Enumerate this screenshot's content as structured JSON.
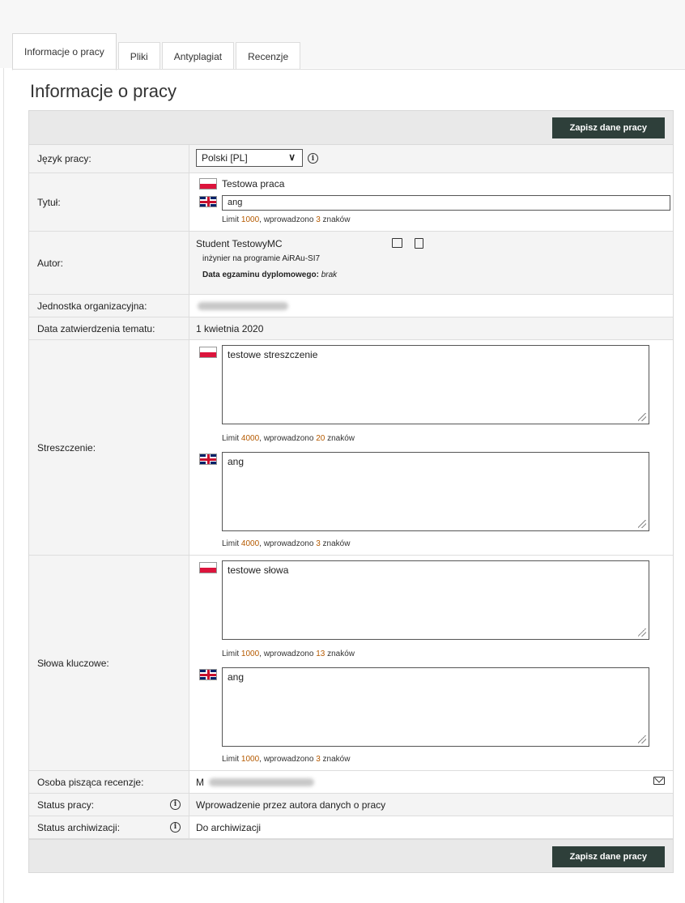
{
  "tabs": [
    {
      "label": "Informacje o pracy",
      "active": true
    },
    {
      "label": "Pliki"
    },
    {
      "label": "Antyplagiat"
    },
    {
      "label": "Recenzje"
    }
  ],
  "page_title": "Informacje o pracy",
  "save_label": "Zapisz dane pracy",
  "rows": {
    "language": {
      "label": "Język pracy:",
      "selected": "Polski [PL]"
    },
    "title": {
      "label": "Tytuł:",
      "pl_text": "Testowa praca",
      "en_value": "ang",
      "limit_prefix": "Limit ",
      "limit": "1000",
      "limit_mid": ", wprowadzono ",
      "count": "3",
      "limit_suffix": " znaków"
    },
    "author": {
      "label": "Autor:",
      "name": "Student TestowyMC",
      "program": "inżynier na programie AiRAu-SI7",
      "exam_label": "Data egzaminu dyplomowego:",
      "exam_value": "brak"
    },
    "org_unit": {
      "label": "Jednostka organizacyjna:"
    },
    "approval_date": {
      "label": "Data zatwierdzenia tematu:",
      "value": "1 kwietnia 2020"
    },
    "abstract": {
      "label": "Streszczenie:",
      "pl_value": "testowe streszczenie",
      "pl_limit": "4000",
      "pl_count": "20",
      "en_value": "ang",
      "en_limit": "4000",
      "en_count": "3"
    },
    "keywords": {
      "label": "Słowa kluczowe:",
      "pl_value": "testowe słowa",
      "pl_limit": "1000",
      "pl_count": "13",
      "en_value": "ang",
      "en_limit": "1000",
      "en_count": "3"
    },
    "reviewer": {
      "label": "Osoba pisząca recenzje:",
      "initial": "M"
    },
    "status": {
      "label": "Status pracy:",
      "value": "Wprowadzenie przez autora danych o pracy"
    },
    "archive_status": {
      "label": "Status archiwizacji:",
      "value": "Do archiwizacji"
    }
  },
  "icons": {
    "info": "info-circle-icon",
    "chevron": "chevron-down-icon",
    "mail": "envelope-icon",
    "photo": "image-icon",
    "document": "document-icon",
    "flag_pl": "flag-pl-icon",
    "flag_gb": "flag-gb-icon"
  },
  "colors": {
    "button_bg": "#2e3f3a",
    "limit_number": "#b55a00",
    "flag_red": "#dc143c"
  }
}
